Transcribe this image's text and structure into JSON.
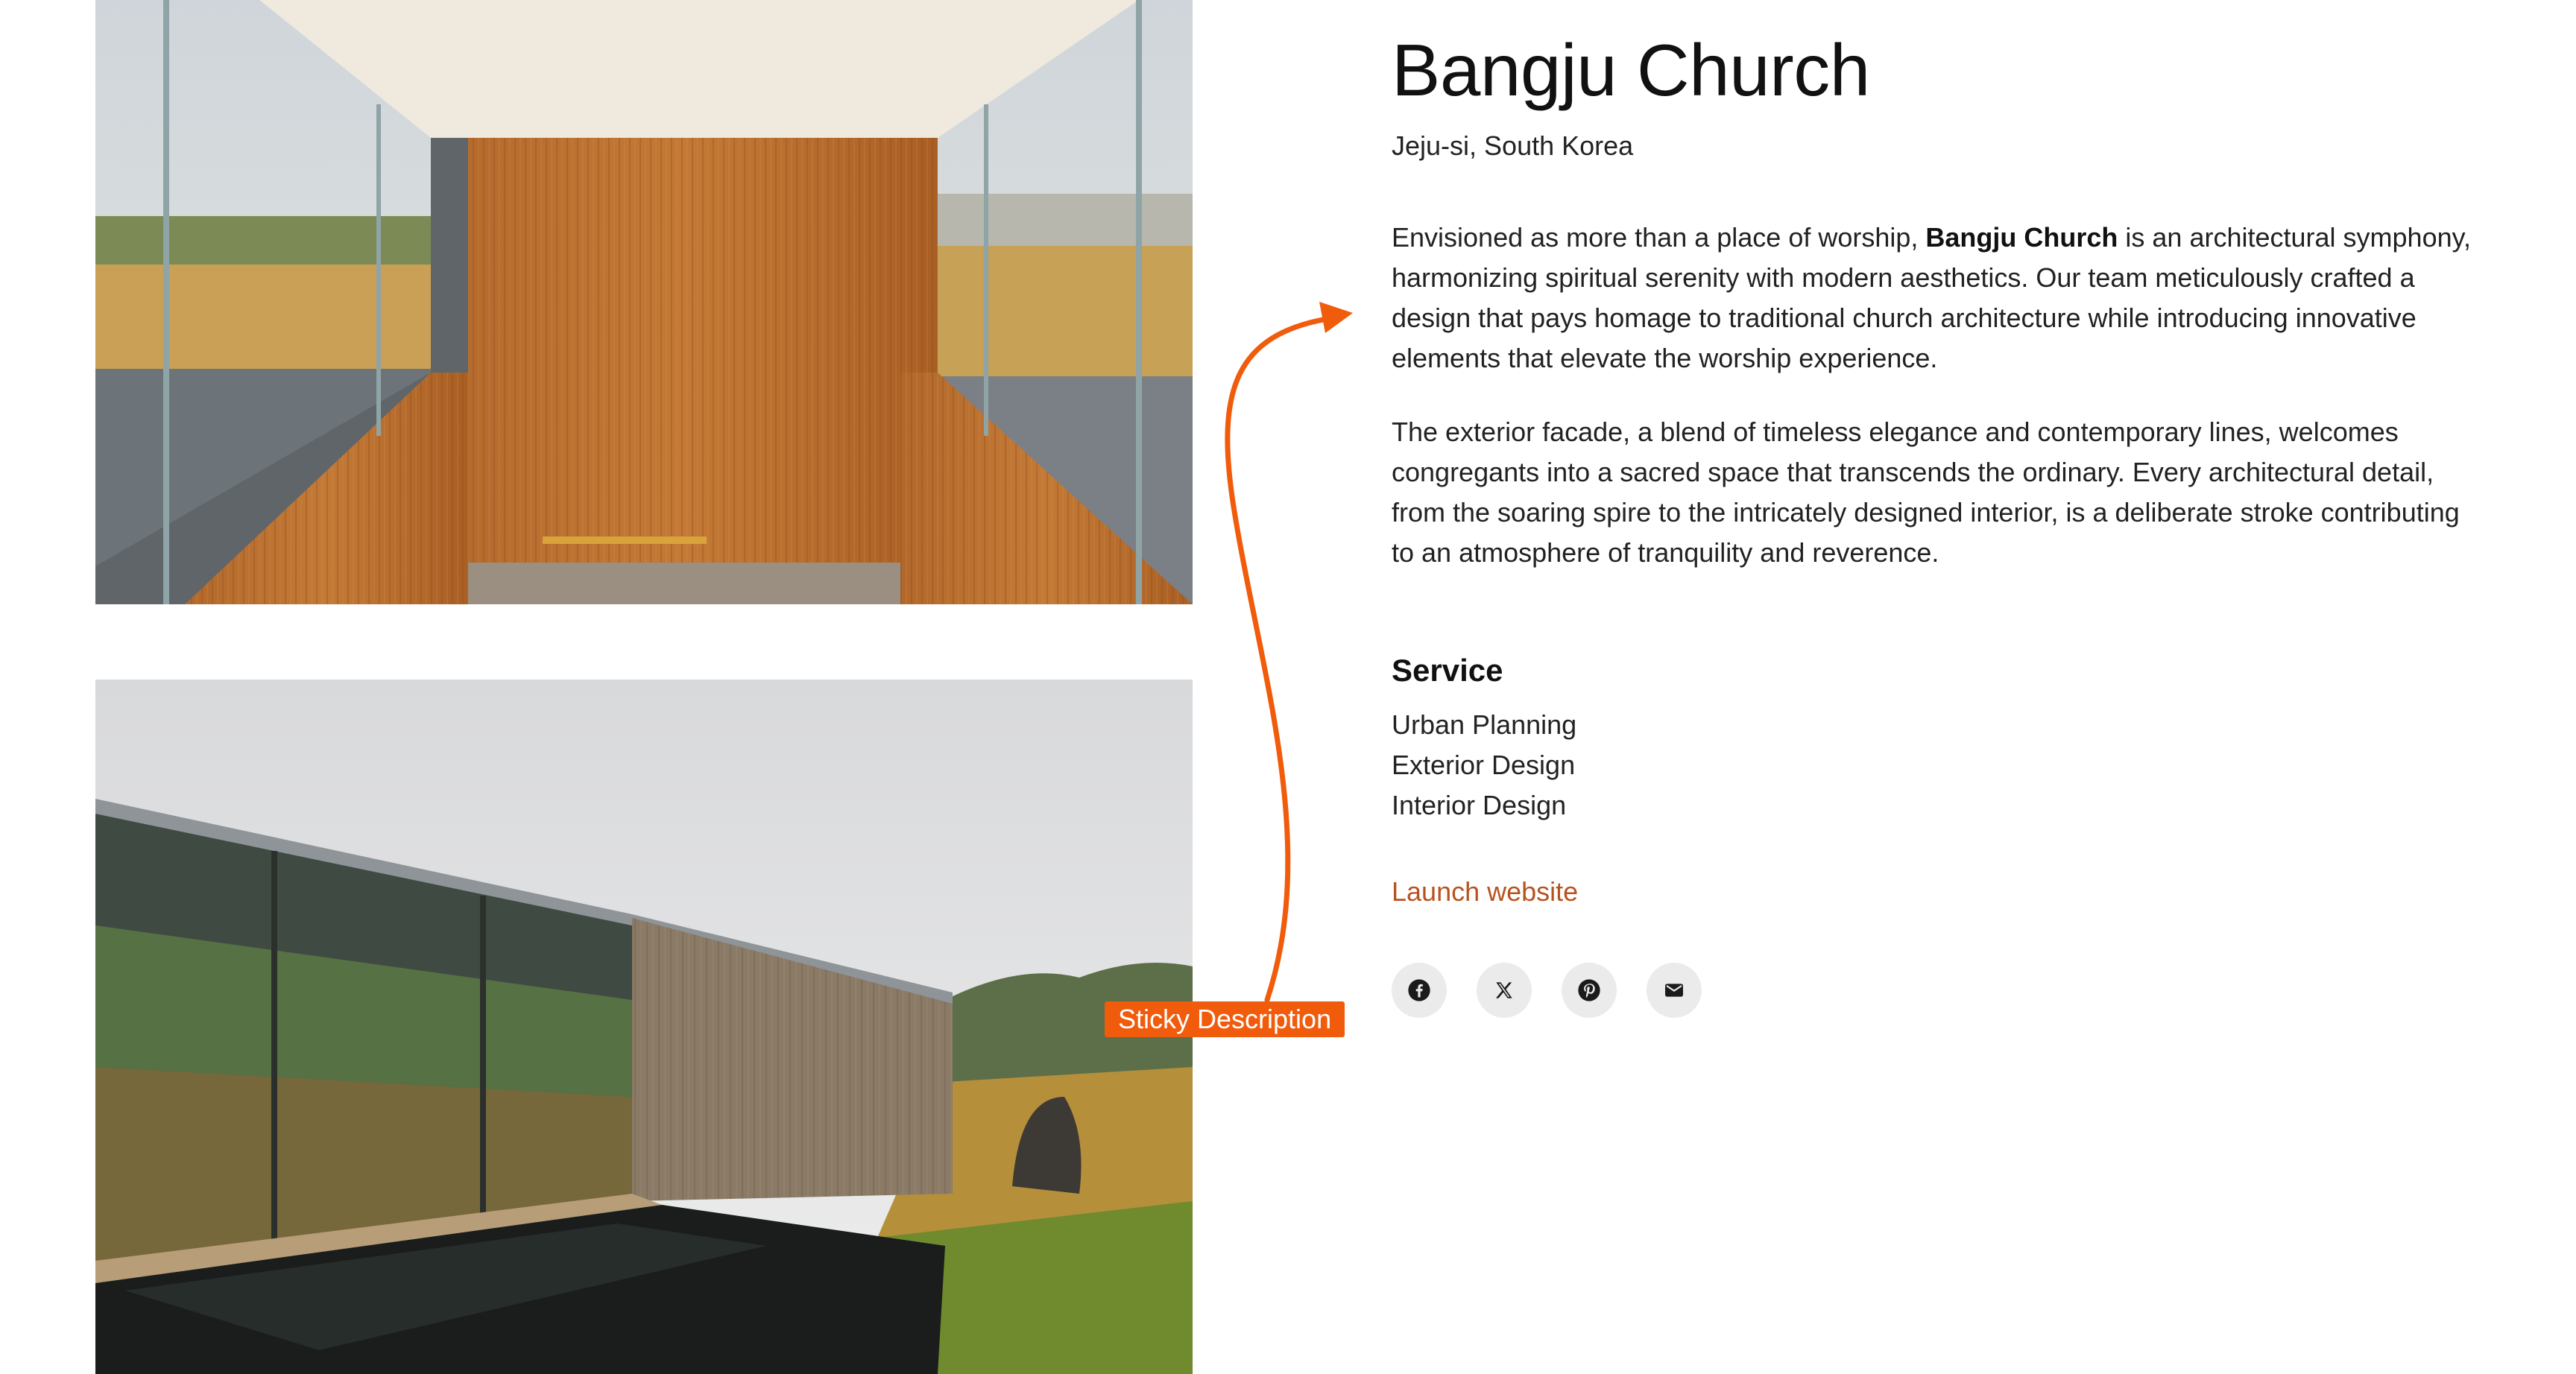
{
  "project": {
    "title": "Bangju Church",
    "location": "Jeju-si, South Korea",
    "para1_before": "Envisioned as more than a place of worship, ",
    "para1_bold": "Bangju Church",
    "para1_after": " is an architectural symphony, harmonizing spiritual serenity with modern aesthetics. Our team meticulously crafted a design that pays homage to traditional church architecture while introducing innovative elements that elevate the worship experience.",
    "para2": "The exterior facade, a blend of timeless elegance and contemporary lines, welcomes congregants into a sacred space that transcends the ordinary. Every architectural detail, from the soaring spire to the intricately designed interior, is a deliberate stroke contributing to an atmosphere of tranquility and reverence."
  },
  "service": {
    "heading": "Service",
    "items": [
      "Urban Planning",
      "Exterior Design",
      "Interior Design"
    ]
  },
  "launch_label": "Launch website",
  "socials": [
    {
      "icon": "facebook-icon"
    },
    {
      "icon": "x-icon"
    },
    {
      "icon": "pinterest-icon"
    },
    {
      "icon": "email-icon"
    }
  ],
  "annotation": {
    "label": "Sticky Description",
    "color": "#f15b0c"
  },
  "colors": {
    "link": "#b8531f",
    "social_bg": "#ebebeb"
  }
}
